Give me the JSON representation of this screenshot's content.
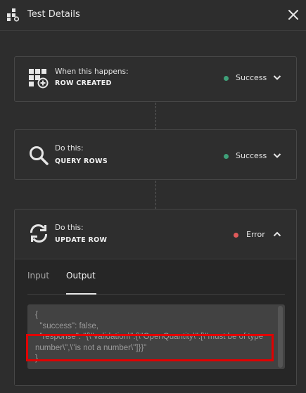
{
  "header": {
    "title": "Test Details",
    "app_icon": "blocks-icon",
    "close_icon": "close-icon"
  },
  "steps": [
    {
      "kicker": "When this happens:",
      "action": "ROW CREATED",
      "icon": "table-add-icon",
      "status": "Success",
      "status_color": "#3fa079",
      "expanded": false
    },
    {
      "kicker": "Do this:",
      "action": "QUERY ROWS",
      "icon": "search-icon",
      "status": "Success",
      "status_color": "#3fa079",
      "expanded": false
    },
    {
      "kicker": "Do this:",
      "action": "UPDATE ROW",
      "icon": "sync-icon",
      "status": "Error",
      "status_color": "#e05a5a",
      "expanded": true
    }
  ],
  "tabs": {
    "input": "Input",
    "output": "Output",
    "selected": "Output"
  },
  "output_code": "{\n  \"success\": false,\n  \"response\": \"{\\\"validation\\\":{\\\"OpenQuantity\\\":[\\\"must be of type number\\\",\\\"is not a number\\\"]}}\"\n}",
  "colors": {
    "background": "#2d2d2d",
    "highlight": "#e10000"
  }
}
